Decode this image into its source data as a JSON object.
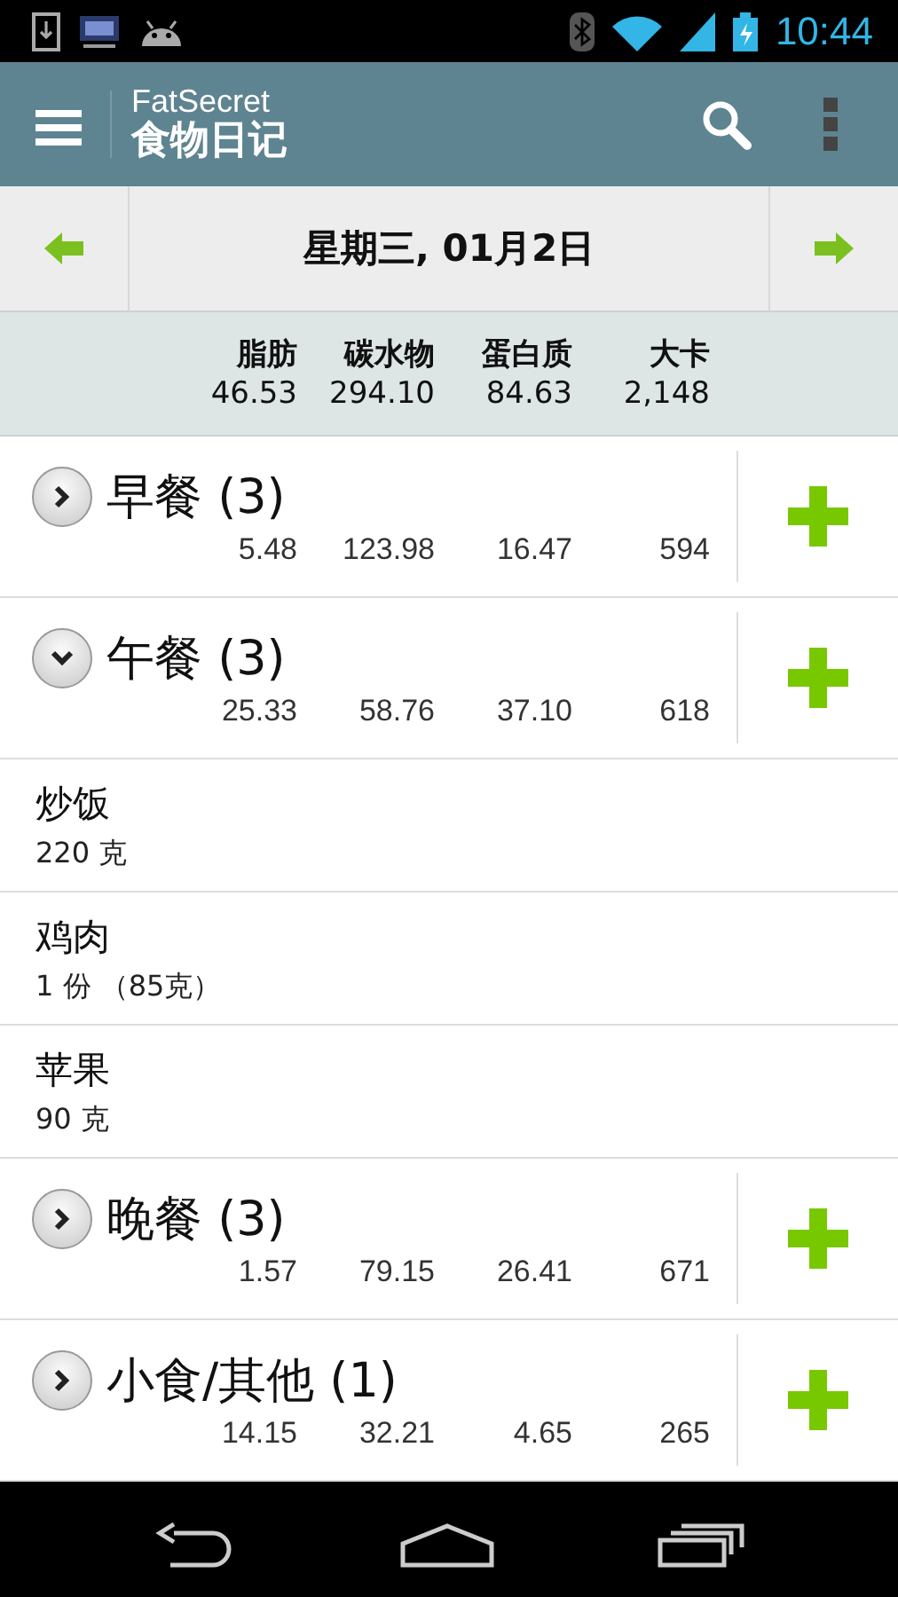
{
  "status_bar": {
    "time": "10:44"
  },
  "app_bar": {
    "brand": "FatSecret",
    "title": "食物日记"
  },
  "date_bar": {
    "date": "星期三, 01月2日"
  },
  "summary": {
    "headers": [
      "脂肪",
      "碳水物",
      "蛋白质",
      "大卡"
    ],
    "values": [
      "46.53",
      "294.10",
      "84.63",
      "2,148"
    ]
  },
  "meals": [
    {
      "name": "早餐 (3)",
      "expanded": false,
      "values": [
        "5.48",
        "123.98",
        "16.47",
        "594"
      ]
    },
    {
      "name": "午餐 (3)",
      "expanded": true,
      "values": [
        "25.33",
        "58.76",
        "37.10",
        "618"
      ],
      "children": [
        {
          "name": "炒饭",
          "amount": "220 克"
        },
        {
          "name": "鸡肉",
          "amount": "1 份 （85克）"
        },
        {
          "name": "苹果",
          "amount": "90 克"
        }
      ]
    },
    {
      "name": "晚餐 (3)",
      "expanded": false,
      "values": [
        "1.57",
        "79.15",
        "26.41",
        "671"
      ]
    },
    {
      "name": "小食/其他 (1)",
      "expanded": false,
      "values": [
        "14.15",
        "32.21",
        "4.65",
        "265"
      ]
    }
  ]
}
